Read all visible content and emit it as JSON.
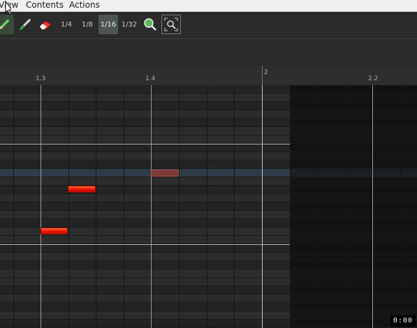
{
  "menu": {
    "items": [
      {
        "label": "View"
      },
      {
        "label": "Contents"
      },
      {
        "label": "Actions"
      }
    ]
  },
  "toolbar": {
    "tools": [
      {
        "icon": "pencil-icon"
      },
      {
        "icon": "brush-icon"
      },
      {
        "icon": "eraser-icon"
      }
    ],
    "grid_options": [
      {
        "label": "1/4",
        "selected": false
      },
      {
        "label": "1/8",
        "selected": false
      },
      {
        "label": "1/16",
        "selected": true
      },
      {
        "label": "1/32",
        "selected": false
      }
    ],
    "zoom_in_icon": "zoom-in-icon",
    "zoom_fit_icon": "zoom-fit-icon"
  },
  "ruler": {
    "labels": [
      "1.3",
      "1.4",
      "2",
      "2.2"
    ]
  },
  "piano_roll": {
    "highlighted_row_color": "#2e3c48",
    "inactive_region_color": "#141414",
    "notes": [
      {
        "row": "highlighted",
        "state": "ghost"
      },
      {
        "row": "middle",
        "state": "active"
      },
      {
        "row": "lower",
        "state": "active"
      }
    ]
  },
  "time_display": "0:00"
}
